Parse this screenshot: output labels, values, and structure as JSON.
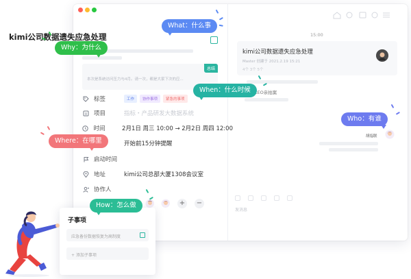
{
  "colors": {
    "what": "#5b8af3",
    "why": "#2fbf4a",
    "when": "#26b3a3",
    "where": "#f2767a",
    "who": "#6d7bef",
    "how": "#2bbd95",
    "accent": "#2bb5a0",
    "close_dot": "#fe5f57",
    "min_dot": "#febb2e",
    "max_dot": "#28c840"
  },
  "task": {
    "title": "kimi公司数据遗失应急处理",
    "desc_tag": "总结",
    "desc_text": "本次是系统访问压力与4月。请一次，都是大家下次的应..."
  },
  "properties": {
    "tags": {
      "label": "标签",
      "items": [
        "工作",
        "协作事项",
        "紧急的事项"
      ]
    },
    "project": {
      "label": "项目",
      "value": "指标・产品研发大数据系统"
    },
    "time": {
      "label": "时间",
      "value": "2月1日 周三 10:00 → 2月2日 周四 12:00"
    },
    "reminder": {
      "label": "",
      "value": "开始前15分钟提醒"
    },
    "start_time": {
      "label": "启动时间"
    },
    "address": {
      "label": "地址",
      "value": "kimi公司总部大厦1308会议室"
    },
    "collaborators": {
      "label": "协作人"
    }
  },
  "chat": {
    "time": "15:00",
    "card_title": "kimi公司数据遗失应急处理",
    "card_meta": "Master 创建于 2021.2.19 15:21",
    "card_stats": "4个        3个        5个",
    "ceo_text": "CEO亲拍案",
    "sender_name": "胡指联",
    "input_placeholder": "发消息"
  },
  "subtasks": {
    "title": "子事项",
    "items": [
      "应急备份数据恢复为高制度"
    ],
    "add_label": "添加子事项"
  },
  "bubbles": {
    "what": "What：什么事",
    "why": "Why：为什么",
    "when": "When：什么时候",
    "where": "Where：在哪里",
    "who": "Who：有谁",
    "how": "How：怎么做"
  },
  "icons": {
    "tag": "tag-icon",
    "project": "clipboard-icon",
    "time": "clock-icon",
    "flag": "flag-icon",
    "location": "location-pin-icon",
    "person": "person-icon",
    "add": "plus-icon",
    "remove": "minus-icon"
  }
}
